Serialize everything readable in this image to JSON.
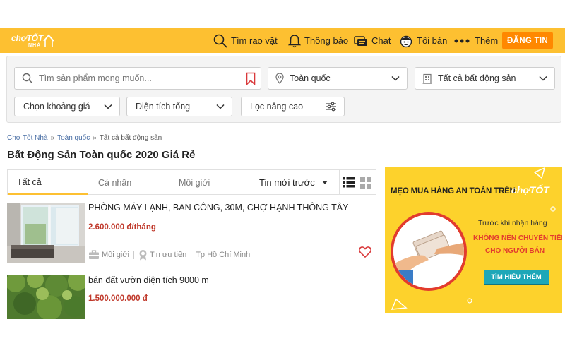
{
  "header": {
    "logo_main": "chợTỐT",
    "logo_sub": "NHÀ",
    "nav": {
      "search": "Tìm rao vặt",
      "notify": "Thông báo",
      "chat": "Chat",
      "sell": "Tôi bán",
      "more": "Thêm"
    },
    "post_button": "ĐĂNG TIN"
  },
  "filters": {
    "search_placeholder": "Tìm sản phẩm mong muốn...",
    "location": "Toàn quốc",
    "category": "Tất cả bất động sản",
    "price": "Chọn khoảng giá",
    "area": "Diện tích tổng",
    "advanced": "Lọc nâng cao"
  },
  "breadcrumb": {
    "items": [
      "Chợ Tốt Nhà",
      "Toàn quốc",
      "Tất cả bất động sản"
    ],
    "separator": "»"
  },
  "page_title": "Bất Động Sản Toàn quốc 2020 Giá Rẻ",
  "tabs": {
    "all": "Tất cả",
    "personal": "Cá nhân",
    "broker": "Môi giới",
    "sort": "Tin mới trước"
  },
  "listings": [
    {
      "title": "PHÒNG MÁY LẠNH, BAN CÔNG, 30M, CHỢ HẠNH THÔNG TÂY",
      "price": "2.600.000 đ/tháng",
      "seller_type": "Môi giới",
      "priority": "Tin ưu tiên",
      "location": "Tp Hồ Chí Minh"
    },
    {
      "title": "bán đất vườn diện tích 9000 m",
      "price": "1.500.000.000 đ"
    }
  ],
  "banner": {
    "headline": "MẸO MUA HÀNG AN TOÀN TRÊN",
    "brand": "chợTỐT",
    "subtitle": "Trước khi nhận hàng",
    "warning_line1": "KHÔNG NÊN CHUYỂN TIỀN",
    "warning_line2": "CHO NGƯỜI BÁN",
    "button": "TÌM HIỂU THÊM"
  },
  "colors": {
    "brand_yellow": "#fdc031",
    "post_button": "#ff8800",
    "price_red": "#c0392b",
    "banner_yellow": "#fdd22c",
    "banner_button": "#1ea7b8"
  }
}
